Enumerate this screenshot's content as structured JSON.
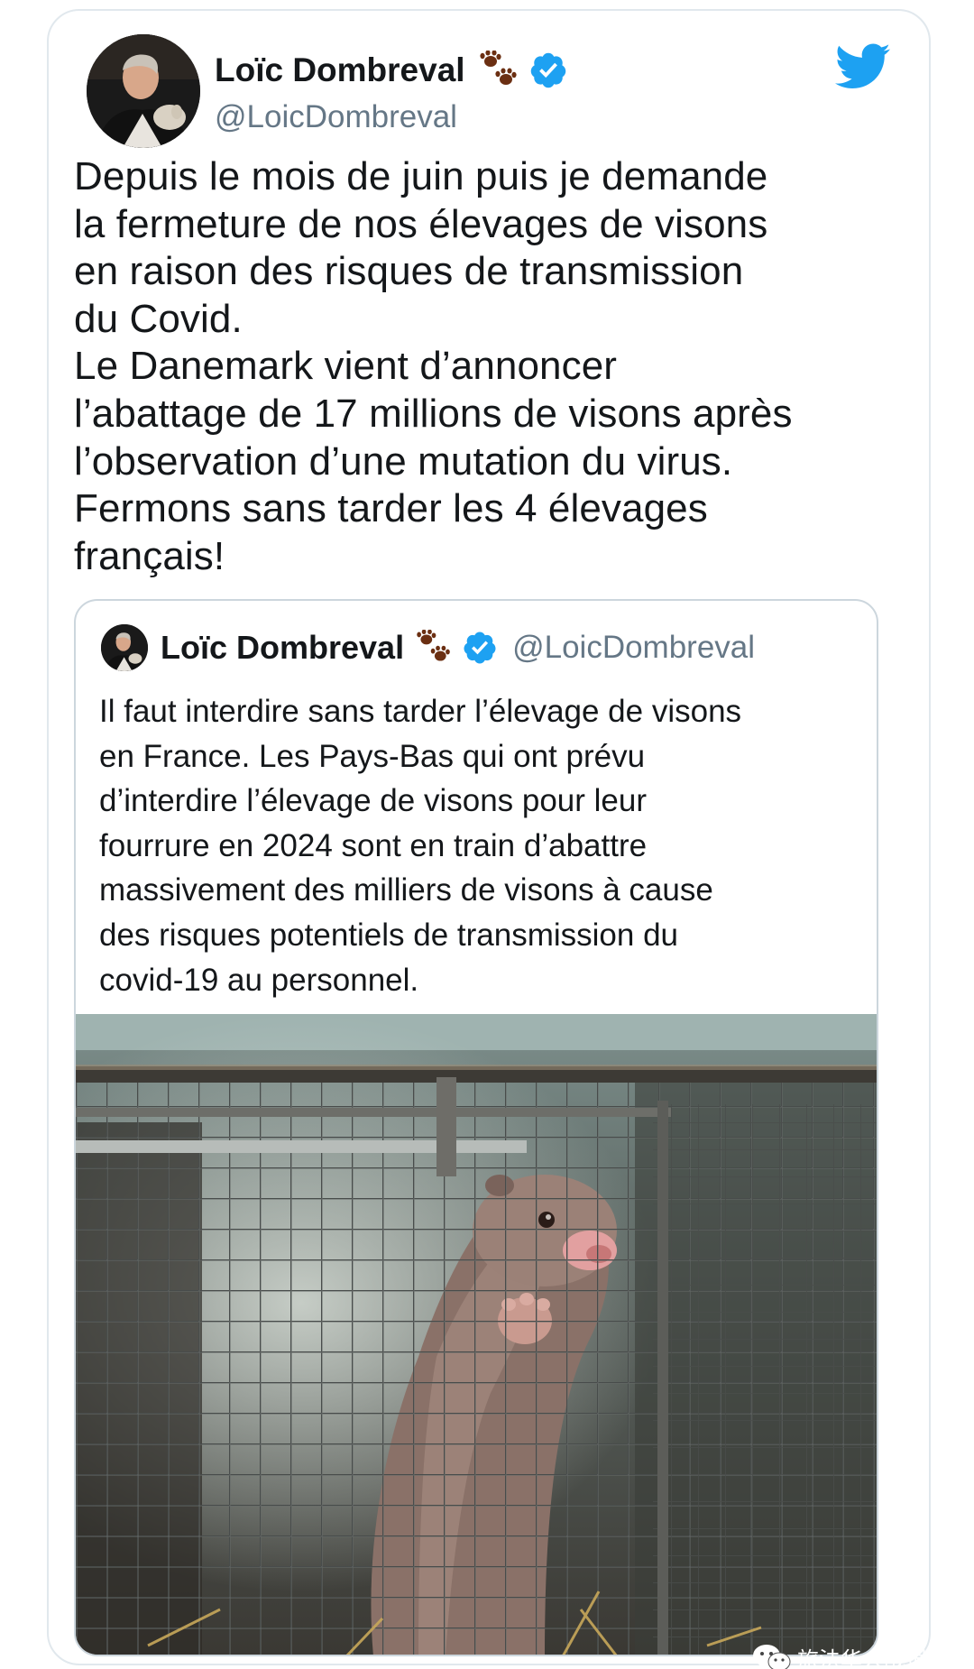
{
  "tweet": {
    "author_name": "Loïc Dombreval",
    "author_handle": "@LoicDombreval",
    "text": "Depuis le mois de juin puis je demande\nla fermeture de nos élevages de visons\nen raison des risques de transmission\ndu Covid.\nLe Danemark vient d’annoncer\nl’abattage de 17 millions de visons après\nl’observation d’une mutation du virus.\nFermons sans tarder les 4 élevages\nfrançais!",
    "icons": [
      "avatar",
      "paw-prints-icon",
      "verified-badge-icon",
      "twitter-bird-icon"
    ]
  },
  "quoted_tweet": {
    "author_name": "Loïc Dombreval",
    "author_handle": "@LoicDombreval",
    "text": "Il faut interdire sans tarder l’élevage de visons\nen France. Les Pays-Bas qui ont prévu\nd’interdire l’élevage de visons pour leur\nfourrure en 2024 sont en train d’abattre\nmassivement des milliers de visons à cause\ndes risques potentiels de transmission du\ncovid-19 au personnel.",
    "image": "mink-in-wire-cage-photo"
  },
  "watermark": {
    "text": "旅法华人战报",
    "icon": "wechat-icon"
  },
  "colors": {
    "text": "#14171a",
    "secondary_text": "#657786",
    "twitter_blue": "#1da1f2",
    "card_border": "#e1e8ed",
    "paw_brown": "#6b2f12"
  }
}
